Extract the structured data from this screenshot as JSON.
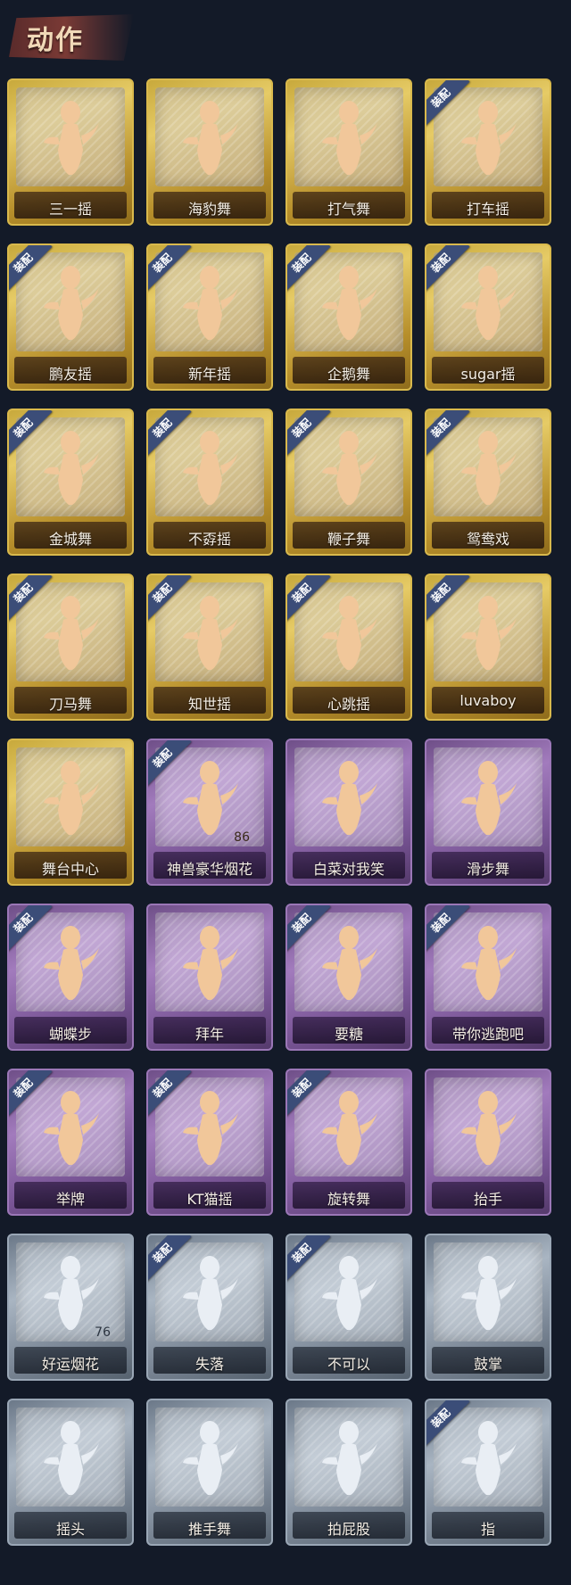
{
  "header": {
    "title": "动作"
  },
  "badge_text": "装配",
  "cards": [
    {
      "label": "三一摇",
      "tier": "gold",
      "equipped": false,
      "icon": "dance-figure-icon"
    },
    {
      "label": "海豹舞",
      "tier": "gold",
      "equipped": false,
      "icon": "dance-figure-icon"
    },
    {
      "label": "打气舞",
      "tier": "gold",
      "equipped": false,
      "icon": "dance-figure-icon"
    },
    {
      "label": "打车摇",
      "tier": "gold",
      "equipped": true,
      "icon": "dance-figure-icon"
    },
    {
      "label": "鹏友摇",
      "tier": "gold",
      "equipped": true,
      "icon": "dance-figure-icon"
    },
    {
      "label": "新年摇",
      "tier": "gold",
      "equipped": true,
      "icon": "dance-figure-icon"
    },
    {
      "label": "企鹅舞",
      "tier": "gold",
      "equipped": true,
      "icon": "dance-figure-icon"
    },
    {
      "label": "sugar摇",
      "tier": "gold",
      "equipped": true,
      "icon": "dance-figure-icon"
    },
    {
      "label": "金城舞",
      "tier": "gold",
      "equipped": true,
      "icon": "dance-figure-icon"
    },
    {
      "label": "不孬摇",
      "tier": "gold",
      "equipped": true,
      "icon": "dance-figure-icon"
    },
    {
      "label": "鞭子舞",
      "tier": "gold",
      "equipped": true,
      "icon": "dance-figure-icon"
    },
    {
      "label": "鸳鸯戏",
      "tier": "gold",
      "equipped": true,
      "icon": "dance-figure-icon"
    },
    {
      "label": "刀马舞",
      "tier": "gold",
      "equipped": true,
      "icon": "dance-figure-icon"
    },
    {
      "label": "知世摇",
      "tier": "gold",
      "equipped": true,
      "icon": "dance-figure-icon"
    },
    {
      "label": "心跳摇",
      "tier": "gold",
      "equipped": true,
      "icon": "dance-figure-icon"
    },
    {
      "label": "luvaboy",
      "tier": "gold",
      "equipped": true,
      "icon": "dance-figure-icon"
    },
    {
      "label": "舞台中心",
      "tier": "gold",
      "equipped": false,
      "icon": "dance-figure-icon"
    },
    {
      "label": "神兽豪华烟花",
      "tier": "purple",
      "equipped": true,
      "icon": "fireworks-icon",
      "count": "86"
    },
    {
      "label": "白菜对我笑",
      "tier": "purple",
      "equipped": false,
      "icon": "dance-figure-icon"
    },
    {
      "label": "滑步舞",
      "tier": "purple",
      "equipped": false,
      "icon": "dance-figure-icon"
    },
    {
      "label": "蝴蝶步",
      "tier": "purple",
      "equipped": true,
      "icon": "dance-figure-icon"
    },
    {
      "label": "拜年",
      "tier": "purple",
      "equipped": false,
      "icon": "bow-figure-icon"
    },
    {
      "label": "要糖",
      "tier": "purple",
      "equipped": true,
      "icon": "ask-figure-icon"
    },
    {
      "label": "带你逃跑吧",
      "tier": "purple",
      "equipped": true,
      "icon": "dance-figure-icon"
    },
    {
      "label": "举牌",
      "tier": "purple",
      "equipped": true,
      "icon": "sign-figure-icon"
    },
    {
      "label": "KT猫摇",
      "tier": "purple",
      "equipped": true,
      "icon": "dance-figure-icon"
    },
    {
      "label": "旋转舞",
      "tier": "purple",
      "equipped": true,
      "icon": "spin-figure-icon"
    },
    {
      "label": "抬手",
      "tier": "purple",
      "equipped": false,
      "icon": "raise-hand-icon"
    },
    {
      "label": "好运烟花",
      "tier": "silver",
      "equipped": false,
      "icon": "firework-can-icon",
      "count": "76"
    },
    {
      "label": "失落",
      "tier": "silver",
      "equipped": true,
      "icon": "crawl-figure-icon"
    },
    {
      "label": "不可以",
      "tier": "silver",
      "equipped": true,
      "icon": "finger-wag-icon"
    },
    {
      "label": "鼓掌",
      "tier": "silver",
      "equipped": false,
      "icon": "clap-hands-icon"
    },
    {
      "label": "摇头",
      "tier": "silver",
      "equipped": false,
      "icon": "headshake-figure-icon"
    },
    {
      "label": "推手舞",
      "tier": "silver",
      "equipped": false,
      "icon": "push-hands-icon"
    },
    {
      "label": "拍屁股",
      "tier": "silver",
      "equipped": false,
      "icon": "slap-figure-icon"
    },
    {
      "label": "指",
      "tier": "silver",
      "equipped": true,
      "icon": "point-figure-icon"
    }
  ]
}
